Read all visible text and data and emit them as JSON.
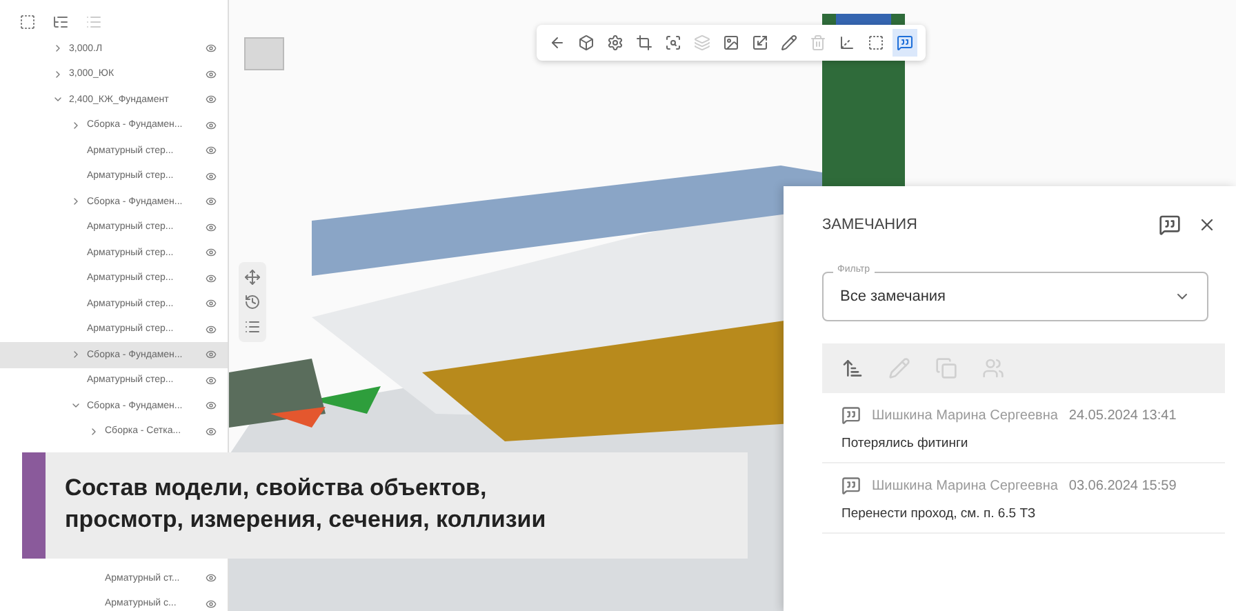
{
  "sidebar": {
    "toolbar": [
      {
        "kind": "frame",
        "disabled": false
      },
      {
        "kind": "tree",
        "disabled": false
      },
      {
        "kind": "list",
        "disabled": true
      }
    ],
    "tree": [
      {
        "label": "3,000.Л",
        "expanded": false,
        "selected": false
      },
      {
        "label": "3,000_ЮК",
        "expanded": false,
        "selected": false
      },
      {
        "label": "2,400_КЖ_Фундамент",
        "expanded": true,
        "selected": false,
        "children": [
          {
            "label": "Сборка - Фундамен...",
            "expanded": false,
            "selected": false
          },
          {
            "label": "Арматурный стер...",
            "selected": false
          },
          {
            "label": "Арматурный стер...",
            "selected": false
          },
          {
            "label": "Сборка - Фундамен...",
            "expanded": false,
            "selected": false
          },
          {
            "label": "Арматурный стер...",
            "selected": false
          },
          {
            "label": "Арматурный стер...",
            "selected": false
          },
          {
            "label": "Арматурный стер...",
            "selected": false
          },
          {
            "label": "Арматурный стер...",
            "selected": false
          },
          {
            "label": "Арматурный стер...",
            "selected": false
          },
          {
            "label": "Сборка - Фундамен...",
            "expanded": false,
            "selected": true
          },
          {
            "label": "Арматурный стер...",
            "selected": false
          },
          {
            "label": "Сборка - Фундамен...",
            "expanded": true,
            "selected": false,
            "children": [
              {
                "label": "Сборка - Сетка...",
                "expanded": false,
                "selected": false
              },
              {
                "label": "Арматурный ст...",
                "selected": false
              },
              {
                "label": "Арматурный с...",
                "selected": false
              }
            ]
          }
        ]
      }
    ]
  },
  "toolbar": [
    {
      "kind": "back",
      "disabled": false,
      "selected": false
    },
    {
      "kind": "box",
      "disabled": false,
      "selected": false
    },
    {
      "kind": "gear",
      "disabled": false,
      "selected": false
    },
    {
      "kind": "crop",
      "disabled": false,
      "selected": false
    },
    {
      "kind": "zoom",
      "disabled": false,
      "selected": false
    },
    {
      "kind": "layers",
      "disabled": true,
      "selected": false
    },
    {
      "kind": "image",
      "disabled": false,
      "selected": false
    },
    {
      "kind": "resize",
      "disabled": false,
      "selected": false
    },
    {
      "kind": "pencil",
      "disabled": false,
      "selected": false
    },
    {
      "kind": "trash",
      "disabled": true,
      "selected": false
    },
    {
      "kind": "axes",
      "disabled": false,
      "selected": false
    },
    {
      "kind": "frame",
      "disabled": false,
      "selected": false
    },
    {
      "kind": "comments",
      "disabled": false,
      "selected": true
    }
  ],
  "side_tools": [
    {
      "kind": "move"
    },
    {
      "kind": "history"
    },
    {
      "kind": "list"
    }
  ],
  "caption": "Состав модели, свойства объектов,\nпросмотр, измерения, сечения, коллизии",
  "comments_panel": {
    "title": "ЗАМЕЧАНИЯ",
    "filter": {
      "label": "Фильтр",
      "value": "Все замечания"
    },
    "actions": [
      {
        "kind": "sort",
        "disabled": false
      },
      {
        "kind": "edit",
        "disabled": true
      },
      {
        "kind": "copy",
        "disabled": true
      },
      {
        "kind": "users",
        "disabled": true
      }
    ],
    "comments": [
      {
        "author": "Шишкина Марина Сергеевна",
        "date": "24.05.2024 13:41",
        "text": "Потерялись фитинги"
      },
      {
        "author": "Шишкина Марина Сергеевна",
        "date": "03.06.2024 15:59",
        "text": "Перенести проход, см. п. 6.5 ТЗ"
      }
    ]
  }
}
